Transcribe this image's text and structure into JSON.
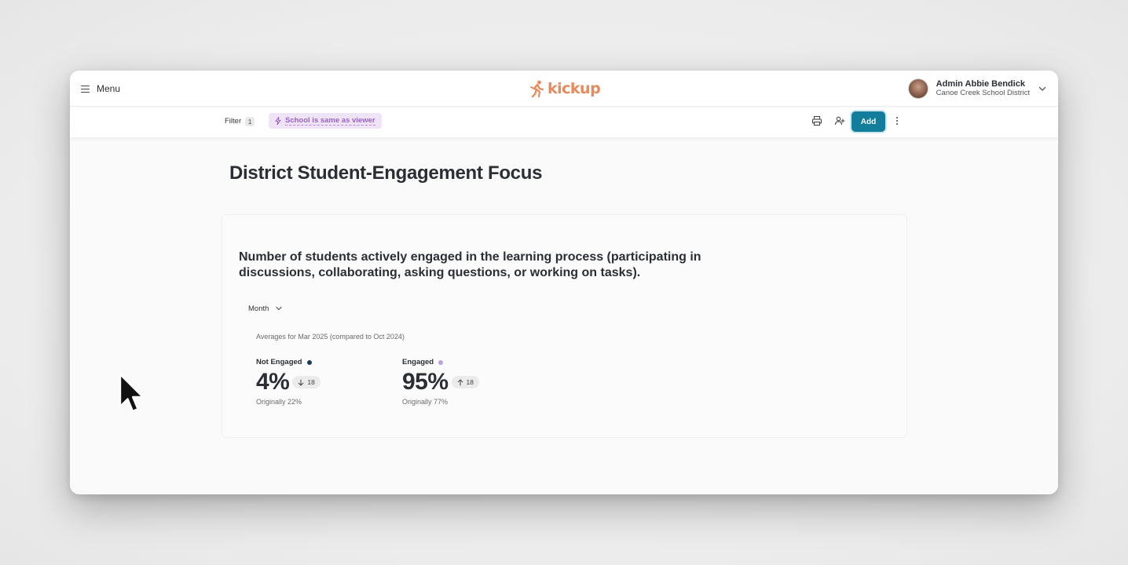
{
  "header": {
    "menu_label": "Menu",
    "logo_text": "kickup",
    "user_name": "Admin Abbie Bendick",
    "user_org": "Canoe Creek School District"
  },
  "toolbar": {
    "filter_label": "Filter",
    "filter_count": "1",
    "school_chip_label": "School is same as viewer",
    "add_label": "Add"
  },
  "page": {
    "title": "District Student-Engagement Focus"
  },
  "card": {
    "title": "Number of students actively engaged in the learning process (participating in discussions, collaborating, asking questions, or working on tasks).",
    "period_label": "Month",
    "averages_text": "Averages for Mar 2025 (compared to Oct 2024)",
    "stats": [
      {
        "label": "Not Engaged",
        "value": "4%",
        "delta": "18",
        "delta_direction": "down",
        "original": "Originally 22%",
        "dot_color": "#1c3d5a"
      },
      {
        "label": "Engaged",
        "value": "95%",
        "delta": "18",
        "delta_direction": "up",
        "original": "Originally 77%",
        "dot_color": "#b9a3d8"
      }
    ]
  },
  "colors": {
    "brand": "#e88a5c",
    "accent": "#127e9c",
    "chip_bg": "#efe4f6",
    "chip_text": "#9a62c4"
  },
  "icons": {
    "menu": "hamburger-icon",
    "print": "printer-icon",
    "share": "add-user-icon",
    "more": "kebab-icon",
    "chevron": "chevron-down-icon",
    "bolt": "bolt-icon"
  }
}
